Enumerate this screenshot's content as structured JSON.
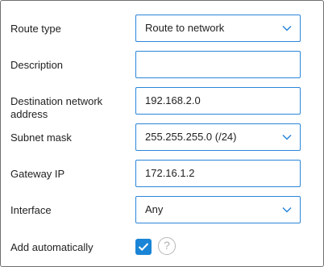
{
  "form": {
    "route_type": {
      "label": "Route type",
      "value": "Route to network"
    },
    "description": {
      "label": "Description",
      "value": ""
    },
    "destination": {
      "label_line1": "Destination network",
      "label_line2": "address",
      "value": "192.168.2.0"
    },
    "subnet_mask": {
      "label": "Subnet mask",
      "value": "255.255.255.0 (/24)"
    },
    "gateway_ip": {
      "label": "Gateway IP",
      "value": "172.16.1.2"
    },
    "interface": {
      "label": "Interface",
      "value": "Any"
    },
    "add_automatically": {
      "label": "Add automatically",
      "checked": true,
      "help_glyph": "?"
    }
  },
  "colors": {
    "accent": "#1a85d6",
    "field_border": "#2a86d9",
    "frame_border": "#6f6f6f",
    "help": "#b0b0b0"
  },
  "icons": {
    "dropdown": "chevron-down-icon",
    "check": "check-icon",
    "help": "question-circle-icon"
  }
}
